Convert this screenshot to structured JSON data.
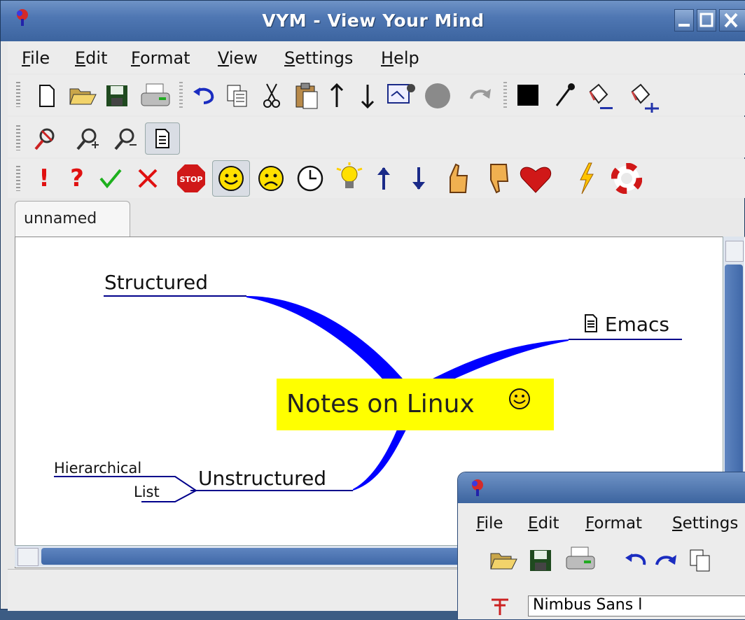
{
  "window": {
    "title": "VYM - View Your Mind"
  },
  "menubar": [
    {
      "label": "File",
      "u": "F",
      "rest": "ile"
    },
    {
      "label": "Edit",
      "u": "E",
      "rest": "dit"
    },
    {
      "label": "Format",
      "u": "F",
      "rest": "ormat"
    },
    {
      "label": "View",
      "u": "V",
      "rest": "iew"
    },
    {
      "label": "Settings",
      "u": "S",
      "rest": "ettings"
    },
    {
      "label": "Help",
      "u": "H",
      "rest": "elp"
    }
  ],
  "tabs": [
    {
      "label": "unnamed"
    }
  ],
  "mindmap": {
    "center": "Notes on Linux",
    "branches": {
      "structured": "Structured",
      "emacs": "Emacs",
      "unstructured": "Unstructured",
      "hierarchical": "Hierarchical",
      "list": "List"
    },
    "colors": {
      "center_bg": "#ffff00",
      "branch": "#0000ff",
      "link": "#00008b"
    }
  },
  "subwindow": {
    "menu": [
      {
        "u": "F",
        "rest": "ile"
      },
      {
        "u": "E",
        "rest": "dit"
      },
      {
        "u": "F",
        "rest": "ormat"
      },
      {
        "u": "S",
        "rest": "ettings"
      }
    ],
    "font_field": "Nimbus Sans l"
  },
  "icons": {
    "toolbar1": [
      "new-file-icon",
      "open-folder-icon",
      "save-icon",
      "print-icon",
      "undo-icon",
      "copy-icon",
      "cut-icon",
      "paste-icon",
      "move-up-icon",
      "move-down-icon",
      "add-image-icon",
      "stop-circle-icon",
      "redo-icon",
      "color-black-icon",
      "pipette-icon",
      "fill-color-icon",
      "fill-branch-icon"
    ],
    "toolbar2": [
      "zoom-reset-icon",
      "zoom-in-icon",
      "zoom-out-icon",
      "note-icon"
    ],
    "toolbar3": [
      "exclamation-icon",
      "question-icon",
      "check-icon",
      "cross-icon",
      "stop-sign-icon",
      "smiley-good-icon",
      "smiley-bad-icon",
      "clock-icon",
      "lightbulb-icon",
      "arrow-up-icon",
      "arrow-down-icon",
      "thumb-up-icon",
      "thumb-down-icon",
      "heart-icon",
      "lightning-icon",
      "lifebuoy-icon"
    ]
  }
}
